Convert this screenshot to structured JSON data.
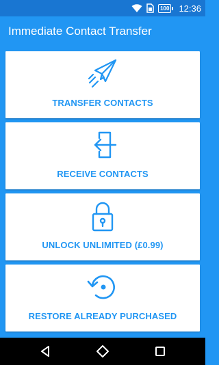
{
  "status_bar": {
    "battery": "100",
    "time": "12:36",
    "icons": [
      "wifi-icon",
      "sim-icon",
      "battery-icon"
    ]
  },
  "app_bar": {
    "title": "Immediate Contact Transfer"
  },
  "actions": [
    {
      "label": "TRANSFER CONTACTS",
      "icon": "paper-plane-icon"
    },
    {
      "label": "RECEIVE CONTACTS",
      "icon": "door-enter-icon"
    },
    {
      "label": "UNLOCK UNLIMITED (£0.99)",
      "icon": "padlock-icon"
    },
    {
      "label": "RESTORE ALREADY PURCHASED",
      "icon": "restore-icon"
    }
  ],
  "nav_bar": {
    "icons": [
      "back-icon",
      "home-icon",
      "recents-icon"
    ]
  },
  "colors": {
    "primary": "#2196F3",
    "primary_dark": "#1976D2",
    "card": "#FFFFFF",
    "nav": "#000000"
  }
}
